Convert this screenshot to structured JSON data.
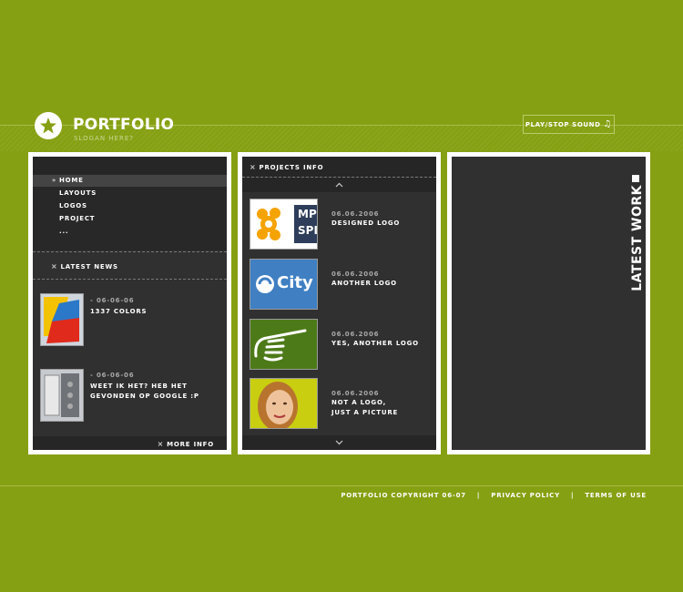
{
  "header": {
    "title": "PORTFOLIO",
    "slogan": "SLOGAN HERE?",
    "sound_button": "PLAY/STOP SOUND",
    "sound_icon": "music-note-icon"
  },
  "nav": {
    "items": [
      "HOME",
      "LAYOUTS",
      "LOGOS",
      "PROJECT",
      "..."
    ]
  },
  "news": {
    "title": "LATEST NEWS",
    "items": [
      {
        "date": "- 06-06-06",
        "text": "1337 COLORS"
      },
      {
        "date": "- 06-06-06",
        "text_line1": "WEET IK HET? HEB HET",
        "text_line2": "GEVONDEN OP GOOGLE :P"
      }
    ],
    "more": "MORE INFO"
  },
  "projects": {
    "title": "PROJECTS INFO",
    "items": [
      {
        "date": "06.06.2006",
        "line1": "DESIGNED LOGO"
      },
      {
        "date": "06.06.2006",
        "line1": "ANOTHER LOGO"
      },
      {
        "date": "06.06.2006",
        "line1": "YES, ANOTHER LOGO"
      },
      {
        "date": "06.06.2006",
        "line1": "NOT A LOGO,",
        "line2": "JUST A PICTURE"
      }
    ],
    "thumb1": {
      "line1": "MP",
      "line2": "SPI"
    },
    "thumb2": {
      "text": "City"
    }
  },
  "latest_work": {
    "title": "LATEST WORK"
  },
  "footer": {
    "copyright": "PORTFOLIO COPYRIGHT 06-07",
    "sep": "|",
    "privacy": "PRIVACY POLICY",
    "terms": "TERMS OF USE"
  },
  "colors": {
    "background": "#86a013",
    "panel": "#303030",
    "frame": "#ffffff"
  }
}
